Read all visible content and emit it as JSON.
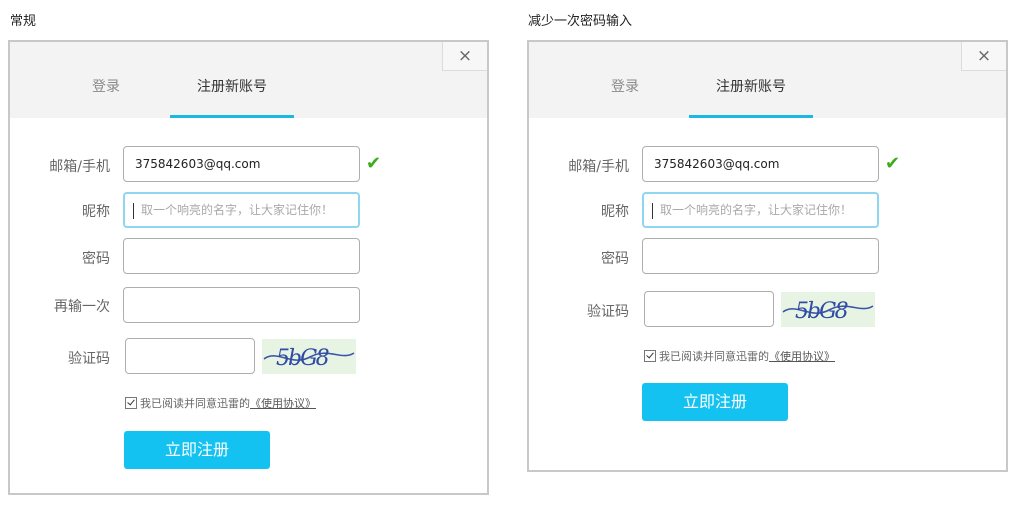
{
  "captions": {
    "left": "常规",
    "right": "减少一次密码输入"
  },
  "close_glyph": "×",
  "tabs": {
    "login": "登录",
    "register": "注册新账号"
  },
  "labels": {
    "email_phone": "邮箱/手机",
    "nickname": "昵称",
    "password": "密码",
    "password_again": "再输一次",
    "captcha": "验证码"
  },
  "fields": {
    "email_value": "375842603@qq.com",
    "nickname_placeholder": "取一个响亮的名字，让大家记住你！"
  },
  "captcha_text": "5bG8",
  "agreement": {
    "prefix": "我已阅读并同意迅雷的",
    "link": "《使用协议》",
    "checked": true
  },
  "submit_label": "立即注册",
  "colors": {
    "accent": "#1cb8e4",
    "button": "#14c2f2",
    "valid": "#3dab1c",
    "focus_border": "#8fd6f0"
  }
}
